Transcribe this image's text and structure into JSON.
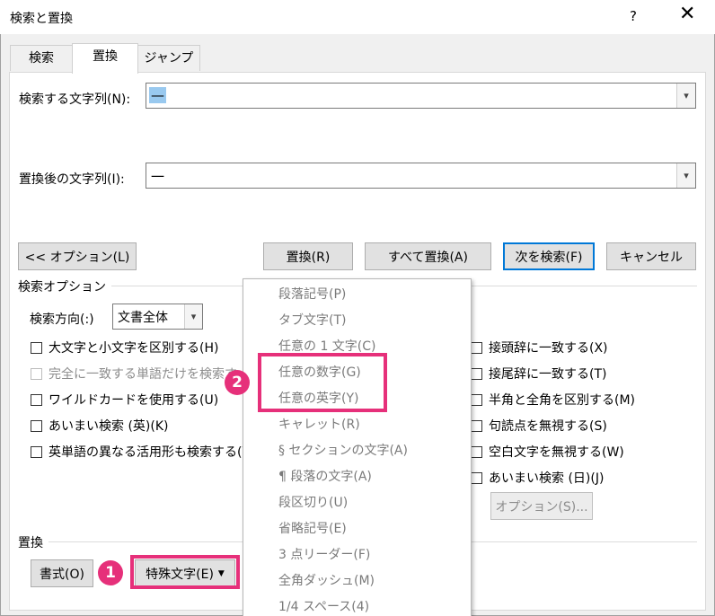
{
  "window": {
    "title": "検索と置換",
    "help": "?",
    "close": "✕"
  },
  "tabs": [
    {
      "label": "検索"
    },
    {
      "label": "置換"
    },
    {
      "label": "ジャンプ"
    }
  ],
  "find": {
    "label": "検索する文字列(N):",
    "value": "—"
  },
  "replace": {
    "label": "置換後の文字列(I):",
    "value": "一"
  },
  "buttons": {
    "options": "<< オプション(L)",
    "replace": "置換(R)",
    "replace_all": "すべて置換(A)",
    "find_next": "次を検索(F)",
    "cancel": "キャンセル",
    "options2": "オプション(S)...",
    "format": "書式(O)",
    "special": "特殊文字(E)"
  },
  "search_options": {
    "group_label": "検索オプション",
    "direction_label": "検索方向(:)",
    "direction_value": "文書全体",
    "left_checks": [
      "大文字と小文字を区別する(H)",
      "完全に一致する単語だけを検索す",
      "ワイルドカードを使用する(U)",
      "あいまい検索 (英)(K)",
      "英単語の異なる活用形も検索する(Y"
    ],
    "right_checks": [
      "接頭辞に一致する(X)",
      "接尾辞に一致する(T)",
      "半角と全角を区別する(M)",
      "句読点を無視する(S)",
      "空白文字を無視する(W)",
      "あいまい検索 (日)(J)"
    ]
  },
  "replace_group_label": "置換",
  "menu": [
    "段落記号(P)",
    "タブ文字(T)",
    "任意の 1 文字(C)",
    "任意の数字(G)",
    "任意の英字(Y)",
    "キャレット(R)",
    "§ セクションの文字(A)",
    "¶ 段落の文字(A)",
    "段区切り(U)",
    "省略記号(E)",
    "3 点リーダー(F)",
    "全角ダッシュ(M)",
    "1/4 スペース(4)"
  ],
  "badges": {
    "one": "1",
    "two": "2"
  },
  "colors": {
    "highlight": "#e6307a",
    "accent": "#0078d7"
  }
}
